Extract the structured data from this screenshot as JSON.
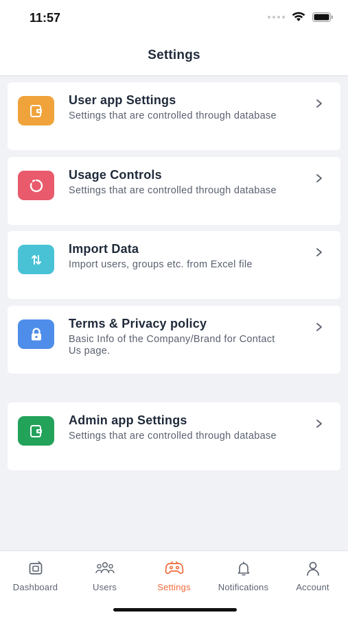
{
  "status_bar": {
    "time": "11:57"
  },
  "header": {
    "title": "Settings"
  },
  "settings_items": [
    {
      "title": "User app Settings",
      "subtitle": "Settings that are controlled through database",
      "icon": "device-settings-icon",
      "color": "#f0a33a"
    },
    {
      "title": "Usage Controls",
      "subtitle": "Settings that are controlled through database",
      "icon": "circular-refresh-icon",
      "color": "#e85a6c"
    },
    {
      "title": "Import Data",
      "subtitle": "Import users, groups etc. from Excel file",
      "icon": "sort-arrows-icon",
      "color": "#49c2d6"
    },
    {
      "title": "Terms & Privacy policy",
      "subtitle": "Basic Info of the Company/Brand for Contact Us page.",
      "icon": "lock-icon",
      "color": "#4e8eea"
    },
    {
      "title": "Admin app Settings",
      "subtitle": "Settings that are controlled through database",
      "icon": "device-settings-icon",
      "color": "#23a25a"
    }
  ],
  "tabs": [
    {
      "label": "Dashboard",
      "icon": "dashboard-icon",
      "active": false
    },
    {
      "label": "Users",
      "icon": "users-icon",
      "active": false
    },
    {
      "label": "Settings",
      "icon": "settings-gamepad-icon",
      "active": true
    },
    {
      "label": "Notifications",
      "icon": "bell-icon",
      "active": false
    },
    {
      "label": "Account",
      "icon": "person-icon",
      "active": false
    }
  ],
  "colors": {
    "accent": "#ef6a3c",
    "background": "#f1f2f6",
    "card": "#ffffff"
  }
}
